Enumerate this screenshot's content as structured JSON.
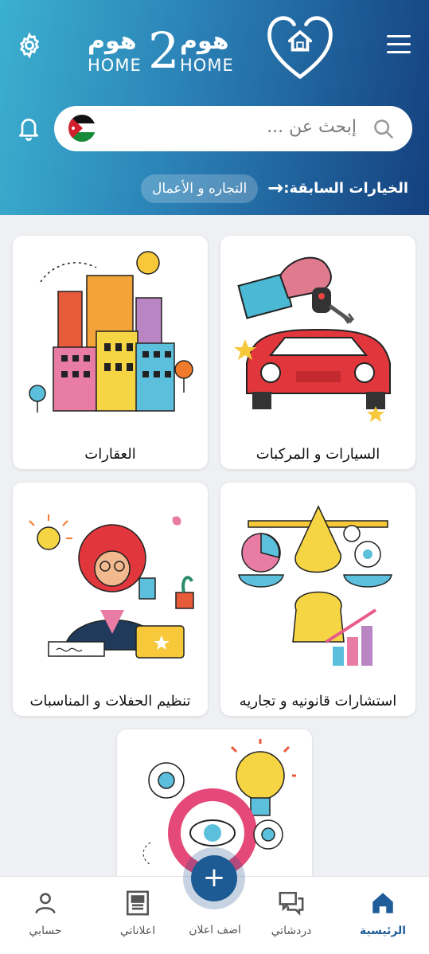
{
  "header": {
    "logo_arabic_left": "هوم",
    "logo_arabic_right": "هوم",
    "logo_number": "2",
    "logo_en_left": "HOME",
    "logo_en_right": "HOME",
    "gear_icon": "gear-icon",
    "menu_icon": "hamburger-menu-icon",
    "bell_icon": "bell-icon"
  },
  "search": {
    "placeholder": "إبحث عن ...",
    "flag": "jordan-flag"
  },
  "previous": {
    "label": "الخيارات السابقة:",
    "chip": "التجاره و الأعمال"
  },
  "categories": [
    {
      "label": "السيارات و المركبات"
    },
    {
      "label": "العقارات"
    },
    {
      "label": "استشارات قانونيه و تجاريه"
    },
    {
      "label": "تنظيم الحفلات و المناسبات"
    }
  ],
  "bottom_nav": {
    "items": [
      {
        "label": "الرئيسية"
      },
      {
        "label": "دردشاتي"
      },
      {
        "label": "اضف اعلان"
      },
      {
        "label": "اعلاناتي"
      },
      {
        "label": "حسابي"
      }
    ],
    "fab_symbol": "+"
  },
  "colors": {
    "header_start": "#3bb0cf",
    "header_end": "#14407e",
    "accent": "#1f5d9a"
  }
}
